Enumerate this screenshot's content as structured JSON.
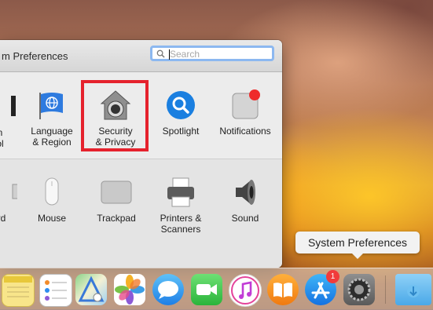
{
  "window": {
    "title": "m Preferences",
    "search_placeholder": "Search"
  },
  "row1_panes": [
    {
      "name": "partial-left",
      "label_line1": "n",
      "label_line2": "ol"
    },
    {
      "name": "language-region",
      "label_line1": "Language",
      "label_line2": "& Region"
    },
    {
      "name": "security-privacy",
      "label_line1": "Security",
      "label_line2": "& Privacy"
    },
    {
      "name": "spotlight",
      "label_line1": "Spotlight",
      "label_line2": ""
    },
    {
      "name": "notifications",
      "label_line1": "Notifications",
      "label_line2": ""
    }
  ],
  "row2_panes": [
    {
      "name": "keyboard-partial",
      "label_line1": "rd",
      "label_line2": ""
    },
    {
      "name": "mouse",
      "label_line1": "Mouse",
      "label_line2": ""
    },
    {
      "name": "trackpad",
      "label_line1": "Trackpad",
      "label_line2": ""
    },
    {
      "name": "printers-scanners",
      "label_line1": "Printers &",
      "label_line2": "Scanners"
    },
    {
      "name": "sound",
      "label_line1": "Sound",
      "label_line2": ""
    }
  ],
  "dock": {
    "tooltip": "System Preferences",
    "appstore_badge": "1",
    "items": [
      "notes",
      "reminders",
      "maps",
      "photos",
      "messages",
      "facetime",
      "itunes",
      "ibooks",
      "app-store",
      "system-preferences",
      "downloads"
    ]
  },
  "colors": {
    "highlight": "#e5222d",
    "search_focus": "#8cb8f0"
  }
}
